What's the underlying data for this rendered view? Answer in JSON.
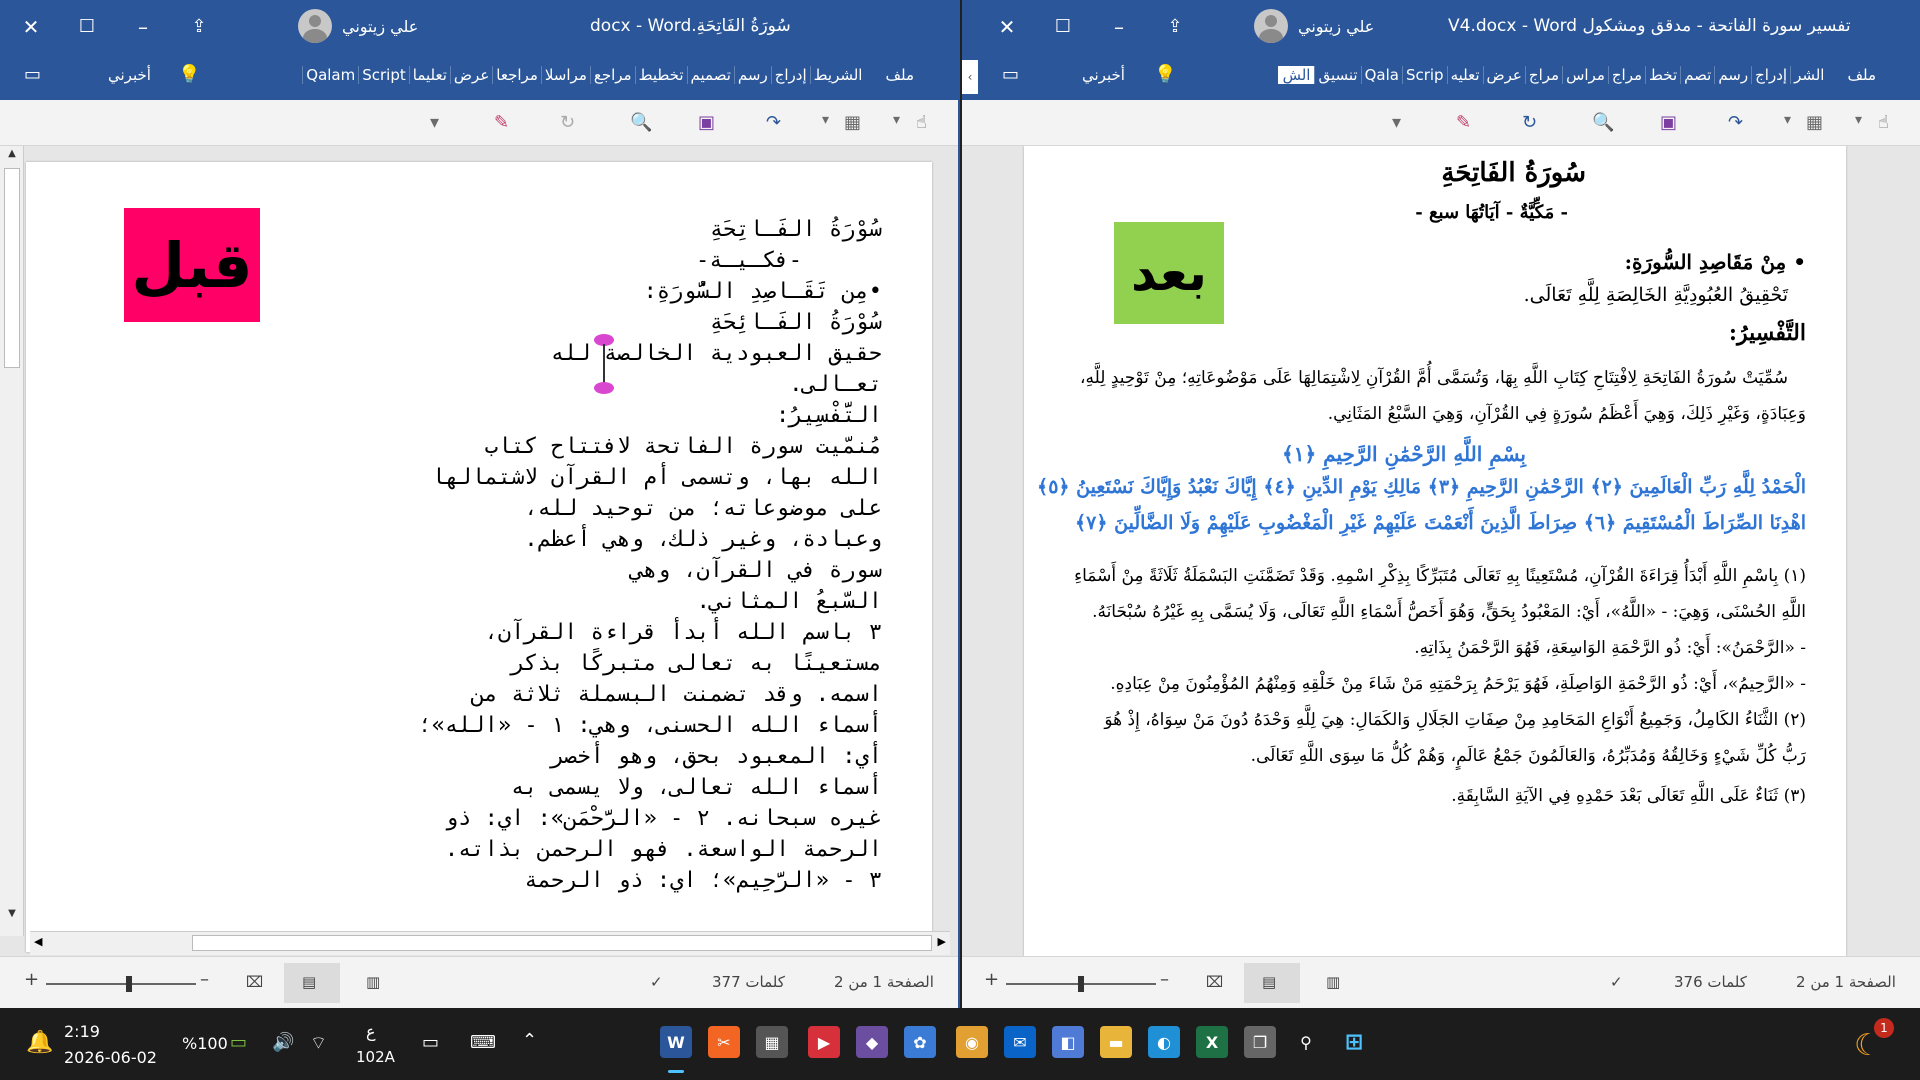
{
  "left_window": {
    "title": "سُورَةُ الفَاتِحَةِ.docx  -  Word",
    "user_name": "علي زيتوني",
    "tabs": [
      "ملف",
      "الشريط",
      "إدراج",
      "رسم",
      "تصميم",
      "تخطيط",
      "مراجع",
      "مراسلا",
      "مراجعا",
      "عرض",
      "تعليما",
      "Script",
      "Qalam"
    ],
    "tell_me": "أخبرني",
    "badge_text": "قبل",
    "badge_color": "#ff0066",
    "doc_lines": [
      "سُوْرَةُ الفَـاتِحَةِ",
      "-فكـيـة-",
      "•مِن تَقَـاصِدِ السُّورَةِ:",
      "سُوْرَةُ الفَـائِحَةِ",
      "حقيق العبودية الخالصة لله",
      "تعـالى.",
      "التَّفْسِيرُ:",
      "مُنمّيت سورة الفاتحة لافتتاح كتاب",
      "الله بها، وتسمى أم القرآن لاشتمالها",
      "على موضوعاته؛ من توحيد لله،",
      "وعبادة، وغير ذلك، وهي أعظم.",
      "سورة في القرآن، وهي",
      "السّبعُ المثاني.",
      "٣ باسم الله أبدأ قراءة القرآن،",
      "مستعينًا به تعالى متبركًا بذكر",
      "اسمه. وقد تضمنت البسملة ثلاثة من",
      "أسماء الله الحسنى، وهي: ١ - «الله»؛",
      "أي: المعبود بحق، وهو أخصر",
      "أسماء الله تعالى، ولا يسمى به",
      "غيره سبحانه. ٢ - «الرَّحْمَن»: اي: ذو",
      "الرحمة الواسعة. فهو الرحمن بذاته.",
      "٣ - «الرَّحِيم»؛ اي: ذو الرحمة"
    ],
    "status_page": "الصفحة 1 من 2",
    "status_words": "377 كلمات"
  },
  "right_window": {
    "title": "تفسير سورة الفاتحة - مدقق ومشكول V4.docx  -  Word",
    "user_name": "علي زيتوني",
    "tabs": [
      "ملف",
      "الشر",
      "إدراج",
      "رسم",
      "تصم",
      "تخط",
      "مراج",
      "مراس",
      "مراج",
      "عرض",
      "تعليه",
      "Scrip",
      "Qala",
      "تنسيق",
      "الش"
    ],
    "tell_me": "أخبرني",
    "badge_text": "بعد",
    "badge_color": "#92d050",
    "doc": {
      "title": "سُورَةُ الفَاتِحَةِ",
      "subtitle": "- مَكِّيَّةٌ - آيَاتُهَا سبع -",
      "goals_heading": "• مِنْ مَقَاصِدِ السُّورَةِ:",
      "goals_text": "تَحْقِيقُ العُبُودِيَّةِ الخَالِصَةِ لِلَّهِ تَعَالَى.",
      "tafsir_heading": "التَّفْسِيرُ:",
      "intro_1": "سُمِّيَتْ سُورَةُ الفَاتِحَةِ لِافْتِتَاحِ كِتَابِ اللَّهِ بِهَا، وَتُسَمَّى أُمَّ القُرْآنِ لِاشْتِمَالِهَا عَلَى مَوْضُوعَاتِهِ؛ مِنْ تَوْحِيدٍ لِلَّهِ،",
      "intro_2": "وَعِبَادَةٍ، وَغَيْرِ ذَلِكَ، وَهِيَ أَعْظَمُ سُورَةٍ فِي القُرْآنِ، وَهِيَ السَّبْعُ المَثَانِي.",
      "verse_1": "بِسْمِ اللَّهِ الرَّحْمَٰنِ الرَّحِيمِ ﴿١﴾",
      "verse_2": "الْحَمْدُ لِلَّهِ رَبِّ الْعَالَمِينَ ﴿٢﴾ الرَّحْمَٰنِ الرَّحِيمِ ﴿٣﴾ مَالِكِ يَوْمِ الدِّينِ ﴿٤﴾ إِيَّاكَ نَعْبُدُ وَإِيَّاكَ نَسْتَعِينُ ﴿٥﴾",
      "verse_3": "اهْدِنَا الصِّرَاطَ الْمُسْتَقِيمَ ﴿٦﴾ صِرَاطَ الَّذِينَ أَنْعَمْتَ عَلَيْهِمْ غَيْرِ الْمَغْضُوبِ عَلَيْهِمْ وَلَا الضَّالِّينَ ﴿٧﴾",
      "p1_1": "(١) بِاسْمِ اللَّهِ أَبْدَأُ قِرَاءَةَ القُرْآنِ، مُسْتَعِينًا بِهِ تَعَالَى مُتَبَرِّكًا بِذِكْرِ اسْمِهِ. وَقَدْ تَضَمَّنَتِ البَسْمَلَةُ ثَلَاثَةً مِنْ أَسْمَاءِ",
      "p1_2": "اللَّهِ الحُسْنَى، وَهِيَ: - «اللَّهُ»، أَيْ: المَعْبُودُ بِحَقٍّ، وَهُوَ أَخَصُّ أَسْمَاءِ اللَّهِ تَعَالَى، وَلَا يُسَمَّى بِهِ غَيْرُهُ سُبْحَانَهُ.",
      "p1_3": "- «الرَّحْمَنُ»: أَيْ: ذُو الرَّحْمَةِ الوَاسِعَةِ، فَهُوَ الرَّحْمَنُ بِذَاتِهِ.",
      "p1_4": "- «الرَّحِيمُ»، أَيْ: ذُو الرَّحْمَةِ الوَاصِلَةِ، فَهُوَ يَرْحَمُ بِرَحْمَتِهِ مَنْ شَاءَ مِنْ خَلْقِهِ وَمِنْهُمُ المُؤْمِنُونَ مِنْ عِبَادِهِ.",
      "p2_1": "(٢) الثَّنَاءُ الكَامِلُ، وَجَمِيعُ أَنْوَاعِ المَحَامِدِ مِنْ صِفَاتِ الجَلَالِ وَالكَمَالِ: هِيَ لِلَّهِ وَحْدَهُ دُونَ مَنْ سِوَاهُ، إِذْ هُوَ",
      "p2_2": "رَبُّ كُلِّ شَيْءٍ وَخَالِقُهُ وَمُدَبِّرُهُ، وَالعَالَمُونَ جَمْعُ عَالَمٍ، وَهُمْ كُلُّ مَا سِوَى اللَّهِ تَعَالَى.",
      "p3_1": "(٣) ثَنَاءٌ عَلَى اللَّهِ تَعَالَى بَعْدَ حَمْدِهِ فِي الآيَةِ السَّابِقَةِ."
    },
    "verse_color": "#2e75d6",
    "status_page": "الصفحة 1 من 2",
    "status_words": "376 كلمات"
  },
  "taskbar": {
    "time": "2:19",
    "date": "2026-06-02",
    "battery": "%100",
    "keyboard_lang": "ع",
    "keyboard_layout": "102A",
    "notification_count": "1"
  }
}
